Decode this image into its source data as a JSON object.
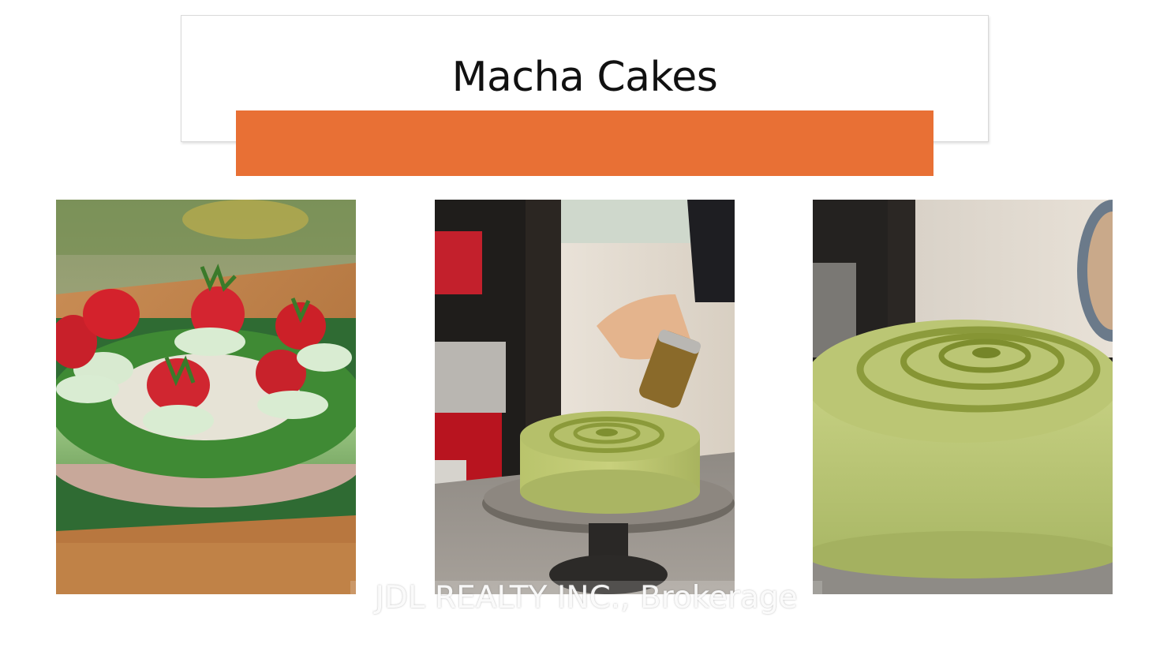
{
  "slide": {
    "title": "Macha Cakes",
    "accent_color": "#e87035"
  },
  "photos": [
    {
      "subject": "matcha cheesecake topped with strawberries and cream"
    },
    {
      "subject": "matcha powder being dusted over a swirled matcha cake on a turntable"
    },
    {
      "subject": "close-up of swirled matcha cake dusted with matcha powder"
    }
  ],
  "watermark": {
    "text": "JDL REALTY INC., Brokerage"
  }
}
